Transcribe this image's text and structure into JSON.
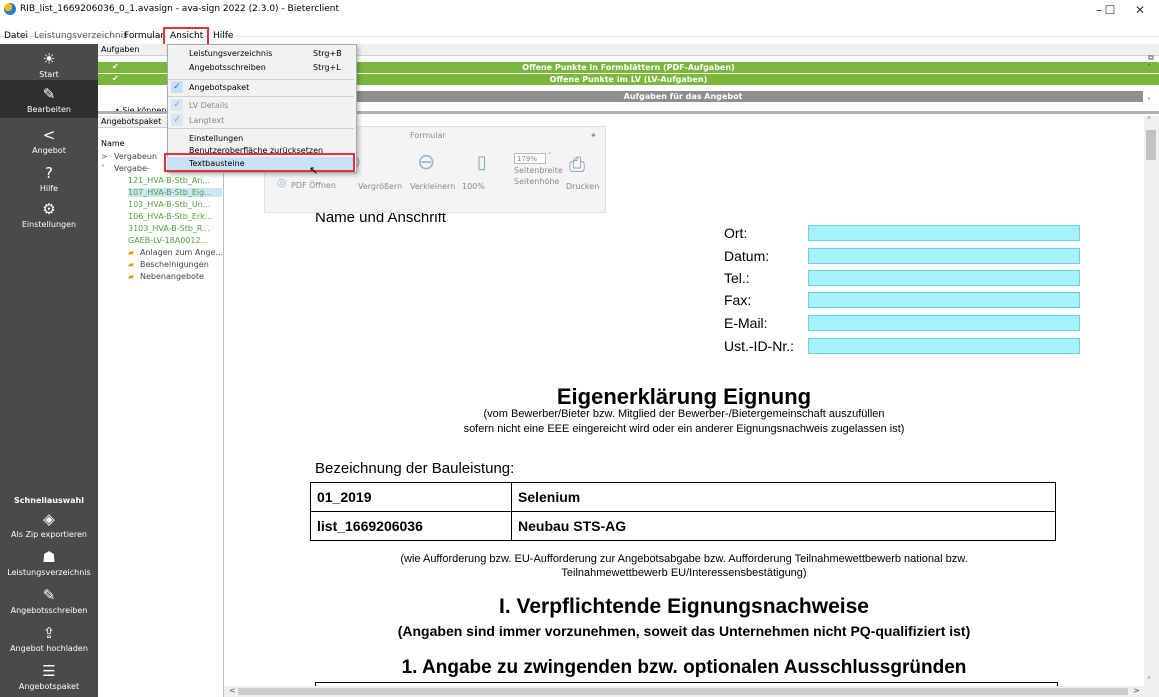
{
  "window": {
    "title": "RIB_list_1669206036_0_1.avasign - ava-sign 2022 (2.3.0) - Bieterclient",
    "minimize": "–",
    "maximize": "☐",
    "close": "✕"
  },
  "menubar": [
    "Datei",
    "Leistungsverzeichnis",
    "Formular",
    "Ansicht",
    "Hilfe"
  ],
  "nav": {
    "items": [
      {
        "label": "Start",
        "icon": "☀"
      },
      {
        "label": "Bearbeiten",
        "icon": "✎"
      },
      {
        "label": "Angebot",
        "icon": "<"
      },
      {
        "label": "Hilfe",
        "icon": "?"
      },
      {
        "label": "Einstellungen",
        "icon": "⚙"
      }
    ],
    "quick_title": "Schnellauswahl",
    "quick": [
      {
        "label": "Als Zip exportieren",
        "icon": "◈"
      },
      {
        "label": "Leistungsverzeichnis",
        "icon": "☗"
      },
      {
        "label": "Angebotsschreiben",
        "icon": "✎"
      },
      {
        "label": "Angebot hochladen",
        "icon": "⇪"
      },
      {
        "label": "Angebotspaket",
        "icon": "☰"
      }
    ]
  },
  "panels": {
    "aufgaben_header": "Aufgaben",
    "sie_koennen": "• Sie können",
    "angebotspaket_header": "Angebotspaket",
    "name_col": "Name",
    "tree": [
      "Vergabeun",
      "Vergabe-",
      "121_HVA-B-Stb_An...",
      "107_HVA-B-Stb_Eig...",
      "103_HVA-B-Stb_Un...",
      "106_HVA-B-Stb_Erk...",
      "3103_HVA-B-Stb_R...",
      "GAEB-LV-18A0012...",
      "Anlagen zum Ange...",
      "Bescheinigungen",
      "Nebenangebote"
    ]
  },
  "tasks": {
    "pdf": "Offene Punkte in Formblättern (PDF-Aufgaben)",
    "lv": "Offene Punkte im LV (LV-Aufgaben)",
    "angebot": "Aufgaben für das Angebot"
  },
  "dropdown": {
    "items": [
      {
        "label": "Leistungsverzeichnis",
        "shortcut": "Strg+B",
        "checked": false
      },
      {
        "label": "Angebotsschreiben",
        "shortcut": "Strg+L",
        "checked": false
      },
      {
        "label": "Angebotspaket",
        "shortcut": "",
        "checked": true
      },
      {
        "label": "LV Details",
        "shortcut": "",
        "checked": true
      },
      {
        "label": "Langtext",
        "shortcut": "",
        "checked": true
      },
      {
        "label": "Einstellungen",
        "shortcut": "",
        "checked": false
      },
      {
        "label": "Benutzeroberfläche zurücksetzen",
        "shortcut": "",
        "checked": false
      },
      {
        "label": "Textbausteine",
        "shortcut": "",
        "checked": false
      }
    ]
  },
  "formular_toolbar": {
    "title": "Formular",
    "pdf_open": "PDF Öffnen",
    "zoom_in": "Vergrößern",
    "zoom_out": "Verkleinern",
    "zoom_100": "100%",
    "zoom_value": "179%",
    "page_width": "Seitenbreite",
    "page_height": "Seitenhöhe",
    "print": "Drucken"
  },
  "document": {
    "name_anschrift": "Name und Anschrift",
    "fields": [
      "Ort:",
      "Datum:",
      "Tel.:",
      "Fax:",
      "E-Mail:",
      "Ust.-ID-Nr.:"
    ],
    "heading": "Eigenerklärung Eignung",
    "sub1": "(vom Bewerber/Bieter bzw. Mitglied der Bewerber-/Bietergemeinschaft auszufüllen",
    "sub2": "sofern nicht eine EEE eingereicht wird oder ein anderer Eignungsnachweis zugelassen ist)",
    "bez_label": "Bezeichnung der Bauleistung:",
    "rows": [
      [
        "01_2019",
        "Selenium"
      ],
      [
        "list_1669206036",
        "Neubau STS-AG"
      ]
    ],
    "note1": "(wie Aufforderung bzw. EU-Aufforderung zur Angebotsabgabe bzw. Aufforderung Teilnahmewettbewerb national bzw.",
    "note2": "Teilnahmewettbewerb EU/Interessensbestätigung)",
    "section1": "I. Verpflichtende Eignungsnachweise",
    "section1_sub": "(Angaben sind immer vorzunehmen, soweit das Unternehmen nicht PQ-qualifiziert ist)",
    "section2": "1.   Angabe zu zwingenden bzw. optionalen Ausschlussgründen"
  },
  "colors": {
    "highlight": "#e2323a",
    "green": "#7bb73e",
    "field": "#a6f2fb",
    "nav": "#4a4a4a"
  }
}
